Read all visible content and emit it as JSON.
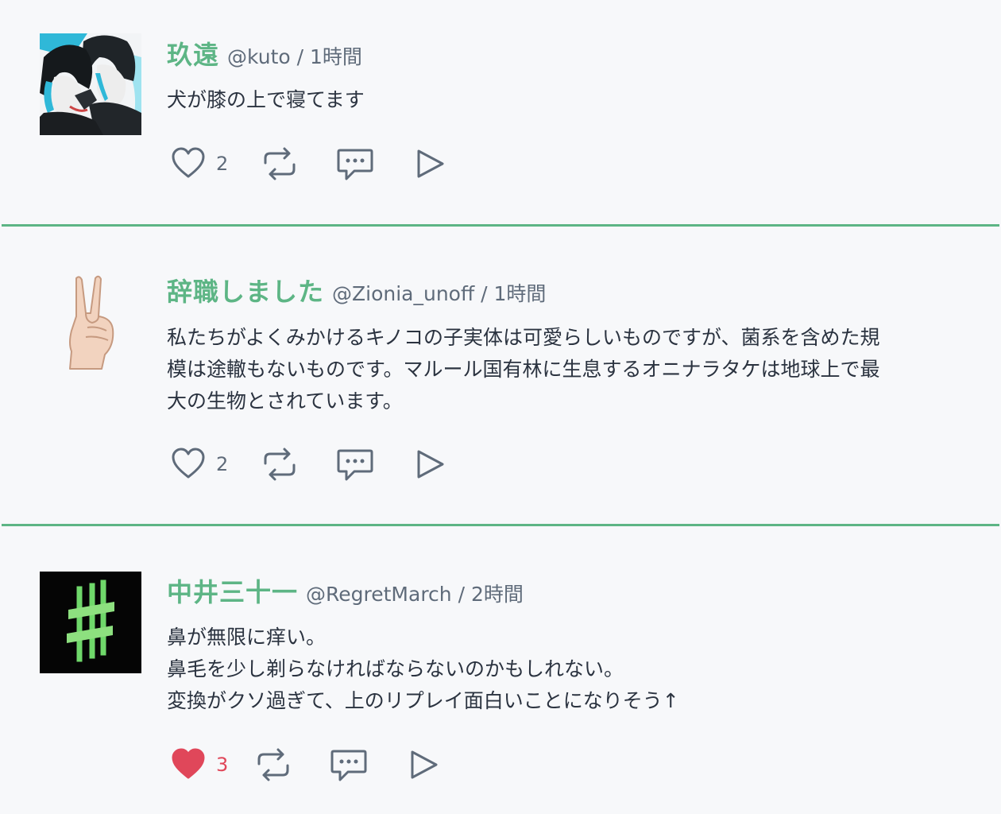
{
  "colors": {
    "accent": "#5db585",
    "divider": "#5db585",
    "meta": "#5f6b7a",
    "liked": "#e0475a",
    "background": "#f7f8fa"
  },
  "posts": [
    {
      "name": "玖遠",
      "meta": "@kuto / 1時間",
      "lines": [
        "犬が膝の上で寝てます"
      ],
      "likes": "2",
      "liked": false,
      "avatar_icon": "anime-avatar-icon"
    },
    {
      "name": "辞職しました",
      "meta": "@Zionia_unoff / 1時間",
      "lines": [
        "私たちがよくみかけるキノコの子実体は可愛らしいものですが、菌系を含めた規",
        "模は途轍もないものです。マルール国有林に生息するオニナラタケは地球上で最",
        "大の生物とされています。"
      ],
      "likes": "2",
      "liked": false,
      "avatar_icon": "peace-hand-icon"
    },
    {
      "name": "中井三十一",
      "meta": "@RegretMarch / 2時間",
      "lines": [
        "鼻が無限に痒い。",
        "鼻毛を少し剃らなければならないのかもしれない。",
        "変換がクソ過ぎて、上のリプレイ面白いことになりそう↑"
      ],
      "likes": "3",
      "liked": true,
      "avatar_icon": "hash-icon"
    }
  ]
}
